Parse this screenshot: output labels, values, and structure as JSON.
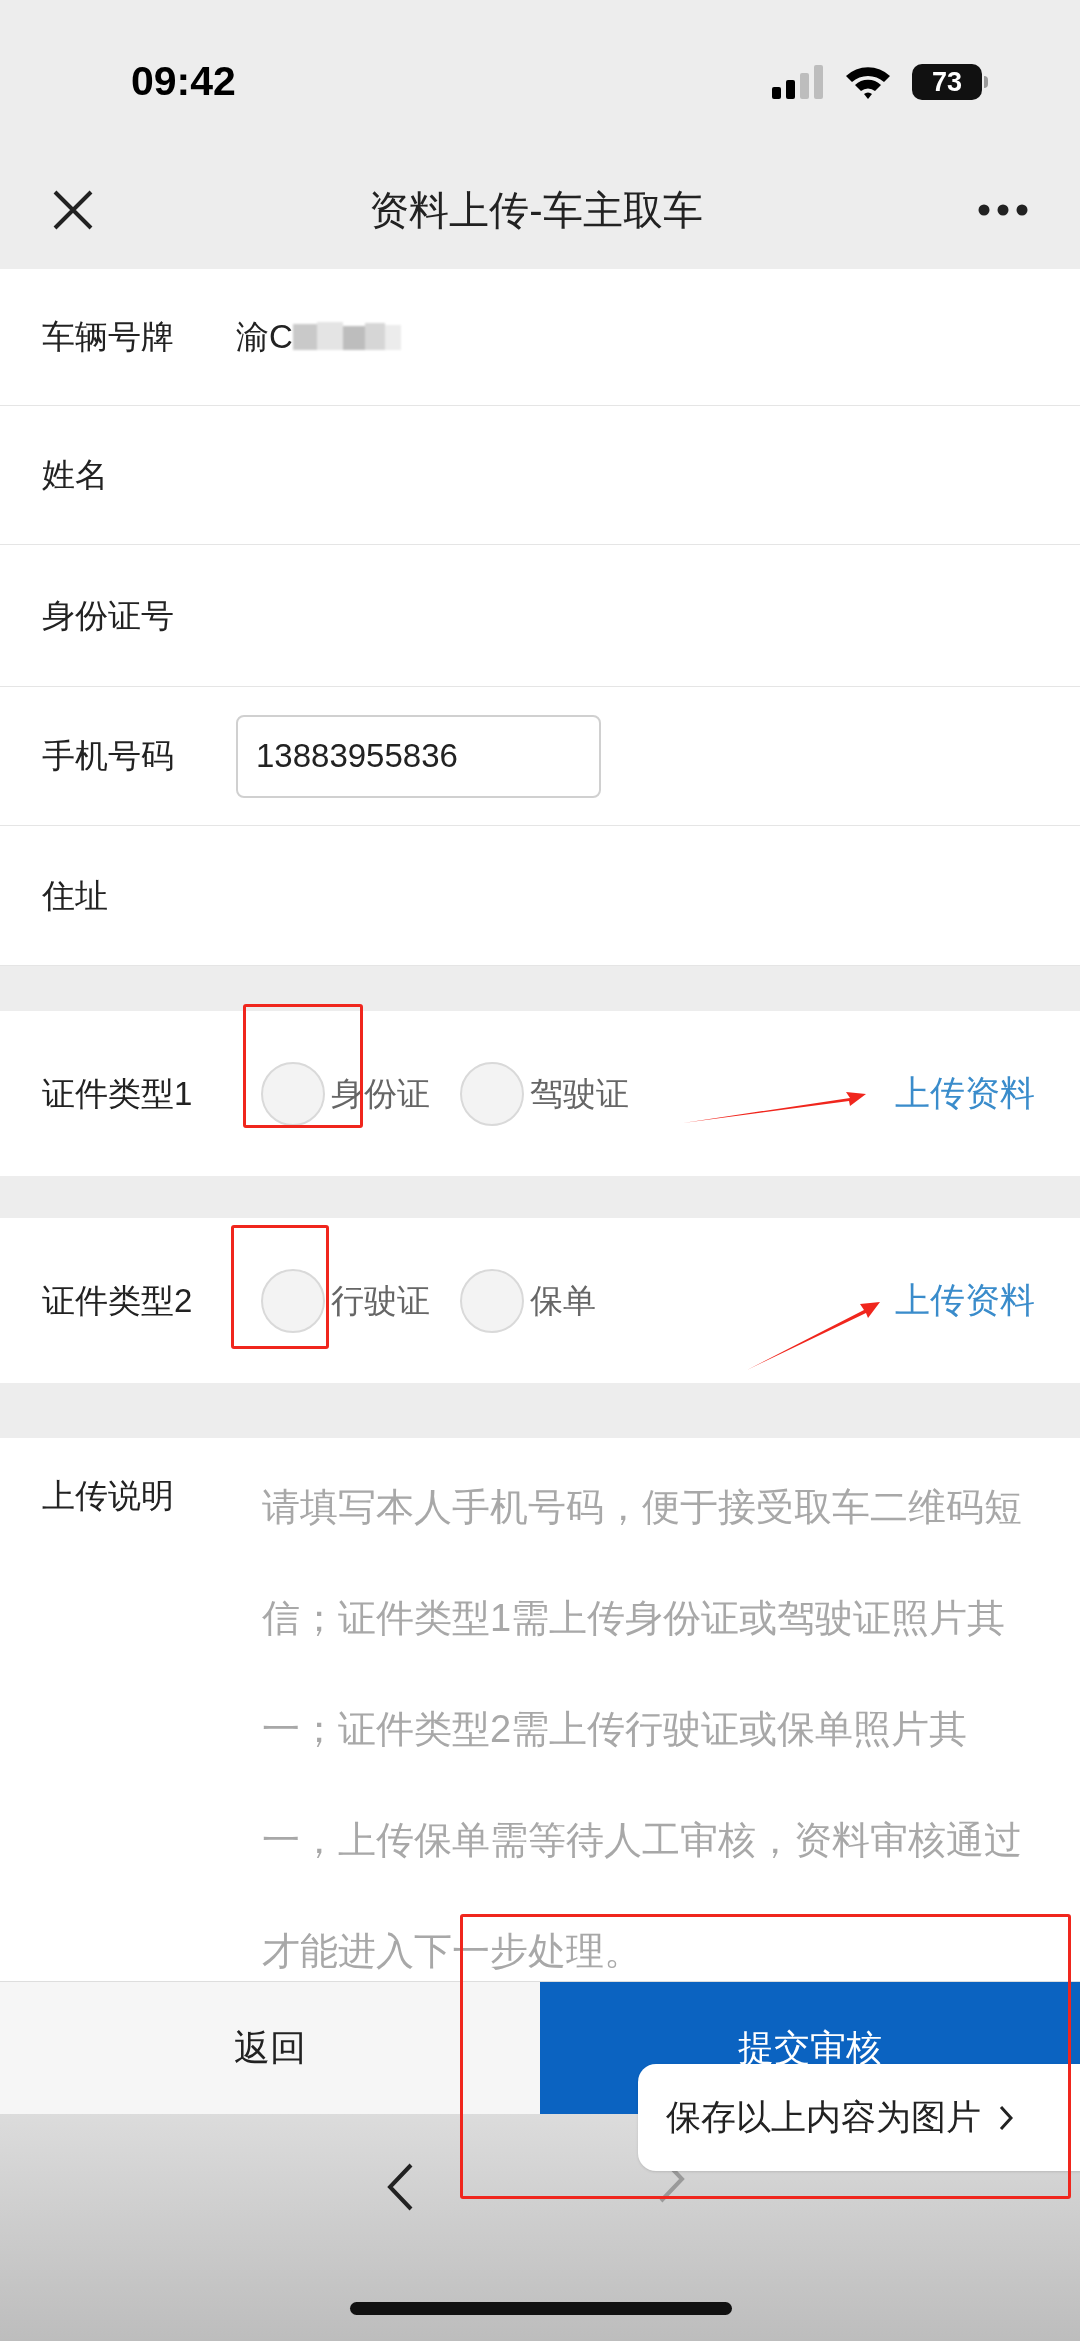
{
  "status_bar": {
    "time": "09:42",
    "battery": "73"
  },
  "header": {
    "title": "资料上传-车主取车"
  },
  "fields": [
    {
      "label": "车辆号牌",
      "kind": "text",
      "value": "渝C",
      "masked": true
    },
    {
      "label": "姓名",
      "kind": "text"
    },
    {
      "label": "身份证号",
      "kind": "text"
    },
    {
      "label": "手机号码",
      "kind": "input",
      "value": "13883955836"
    },
    {
      "label": "住址",
      "kind": "text"
    }
  ],
  "document_types": [
    {
      "label": "证件类型1",
      "options": [
        {
          "label": "身份证",
          "selected": false
        },
        {
          "label": "驾驶证",
          "selected": false
        }
      ],
      "action": "上传资料"
    },
    {
      "label": "证件类型2",
      "options": [
        {
          "label": "行驶证",
          "selected": false
        },
        {
          "label": "保单",
          "selected": false
        }
      ],
      "action": "上传资料"
    }
  ],
  "instructions": {
    "label": "上传说明",
    "text": "请填写本人手机号码，便于接受取车二维码短信；证件类型1需上传身份证或驾驶证照片其一；证件类型2需上传行驶证或保单照片其一，上传保单需等待人工审核，资料审核通过才能进入下一步处理。"
  },
  "buttons": [
    {
      "label": "返回",
      "kind": "secondary"
    },
    {
      "label": "提交审核",
      "kind": "primary"
    }
  ],
  "popup": {
    "text": "保存以上内容为图片"
  }
}
